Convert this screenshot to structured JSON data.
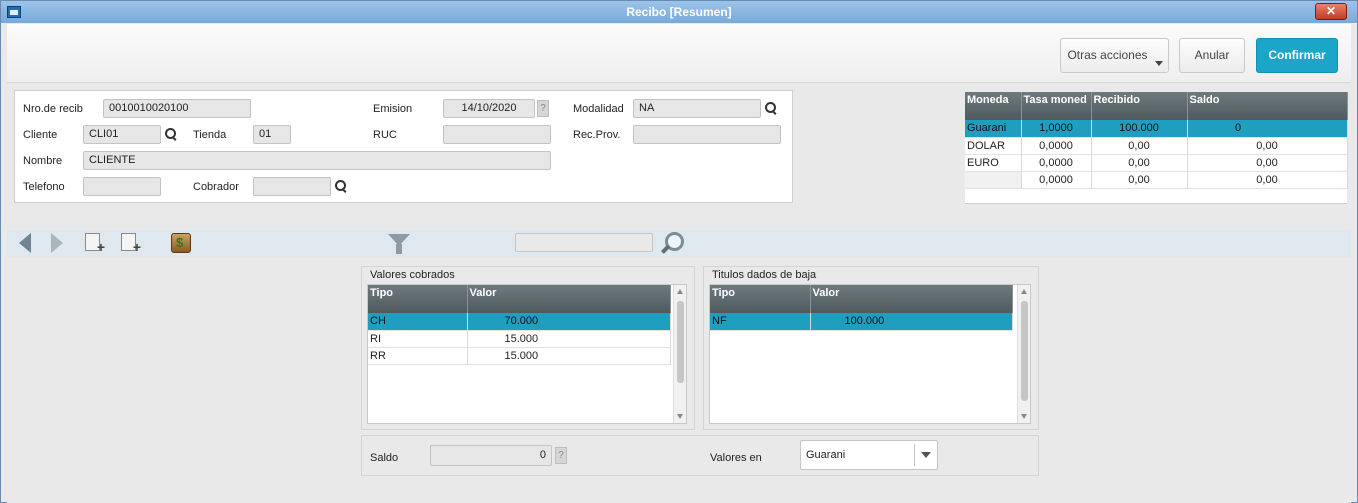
{
  "window": {
    "title": "Recibo [Resumen]",
    "close_label": "✕"
  },
  "actions": {
    "otras": "Otras acciones",
    "anular": "Anular",
    "confirmar": "Confirmar"
  },
  "header": {
    "nro_label": "Nro.de recib",
    "nro_value": "0010010020100",
    "emision_label": "Emision",
    "emision_value": "14/10/2020",
    "help_label": "?",
    "modalidad_label": "Modalidad",
    "modalidad_value": "NA",
    "cliente_label": "Cliente",
    "cliente_value": "CLI01",
    "tienda_label": "Tienda",
    "tienda_value": "01",
    "ruc_label": "RUC",
    "ruc_value": "",
    "recprov_label": "Rec.Prov.",
    "recprov_value": "",
    "nombre_label": "Nombre",
    "nombre_value": "CLIENTE",
    "telefono_label": "Telefono",
    "telefono_value": "",
    "cobrador_label": "Cobrador",
    "cobrador_value": ""
  },
  "currency_table": {
    "columns": [
      "Moneda",
      "Tasa moned",
      "Recibido",
      "Saldo"
    ],
    "rows": [
      [
        "Guarani",
        "1,0000",
        "100.000",
        "0"
      ],
      [
        "DOLAR",
        "0,0000",
        "0,00",
        "0,00"
      ],
      [
        "EURO",
        "0,0000",
        "0,00",
        "0,00"
      ],
      [
        "",
        "0,0000",
        "0,00",
        "0,00"
      ]
    ]
  },
  "toolbar": {
    "search_value": ""
  },
  "valores_cobrados": {
    "title": "Valores cobrados",
    "columns": [
      "Tipo",
      "Valor"
    ],
    "rows": [
      [
        "CH",
        "70.000"
      ],
      [
        "RI",
        "15.000"
      ],
      [
        "RR",
        "15.000"
      ]
    ]
  },
  "titulos_baja": {
    "title": "Titulos dados de baja",
    "columns": [
      "Tipo",
      "Valor"
    ],
    "rows": [
      [
        "NF",
        "100.000"
      ]
    ]
  },
  "footer": {
    "saldo_label": "Saldo",
    "saldo_value": "0",
    "help_label": "?",
    "valores_en_label": "Valores en",
    "valores_en_value": "Guarani"
  },
  "colors": {
    "accent": "#1aa5c9",
    "selected_row": "#1f9ec0",
    "grid_header": "#5a656a"
  }
}
